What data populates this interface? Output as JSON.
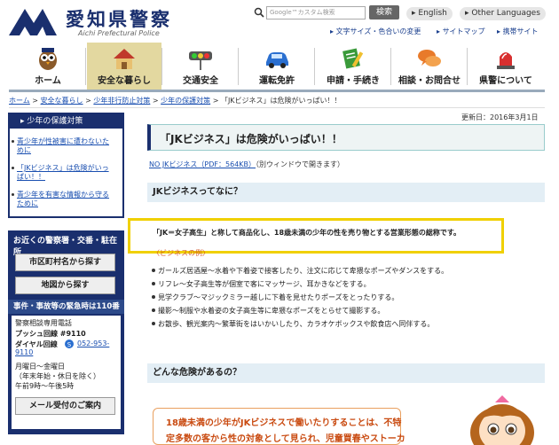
{
  "header": {
    "logo_text": "愛知県警察",
    "logo_sub": "Aichi Prefectural Police",
    "search_placeholder": "Google™カスタム検索",
    "search_button": "検索",
    "lang_english": "English",
    "lang_other": "Other Languages",
    "tools": [
      "文字サイズ・色合いの変更",
      "サイトマップ",
      "携帯サイト"
    ]
  },
  "nav": {
    "items": [
      {
        "label": "ホーム",
        "icon": "owl-icon"
      },
      {
        "label": "安全な暮らし",
        "icon": "house-icon"
      },
      {
        "label": "交通安全",
        "icon": "traffic-light-icon"
      },
      {
        "label": "運転免許",
        "icon": "car-icon"
      },
      {
        "label": "申請・手続き",
        "icon": "document-pencil-icon"
      },
      {
        "label": "相談・お問合せ",
        "icon": "speech-bubbles-icon"
      },
      {
        "label": "県警について",
        "icon": "siren-icon"
      }
    ],
    "active_index": 1
  },
  "breadcrumb": {
    "links": [
      "ホーム",
      "安全な暮らし",
      "少年非行防止対策",
      "少年の保護対策"
    ],
    "separator": " > ",
    "current": "「JKビジネス」は危険がいっぱい！！"
  },
  "sidebar": {
    "section_title": "少年の保護対策",
    "items": [
      "青少年が性被害に遭わないために",
      "「JKビジネス」は危険がいっぱい！！",
      "青少年を有害な情報から守るために"
    ],
    "police_title": "お近くの警察署・交番・駐在所",
    "btn_city": "市区町村名から探す",
    "btn_map": "地図から探す",
    "emergency_title": "事件・事故等の緊急時は110番",
    "contact": {
      "label1": "警察相談専用電話",
      "push": "プッシュ回線 #9110",
      "dial_label": "ダイヤル回線",
      "dial_num": "052-953-",
      "dial_num2": "9110",
      "hours1": "月曜日～金曜日",
      "hours2": "（年末年始・休日を除く）",
      "hours3": "午前9時～午後5時",
      "mail_button": "メール受付のご案内"
    }
  },
  "main": {
    "updated": "更新日：2016年3月1日",
    "title": "「JKビジネス」は危険がいっぱい！！",
    "pdf_link": "NO JKビジネス（PDF：564KB）",
    "pdf_note": "（別ウィンドウで開きます）",
    "section1": "JKビジネスってなに？",
    "definition": "「JK＝女子高生」と称して商品化し、18歳未満の少年の性を売り物とする営業形態の総称です。",
    "example_label": "〈ビジネスの例〉",
    "examples": [
      "ガールズ居酒屋～水着や下着姿で接客したり、注文に応じて卑猥なポーズやダンスをする。",
      "リフレ～女子高生等が個室で客にマッサージ、耳かきなどをする。",
      "見学クラブ～マジックミラー越しに下着を見せたりポーズをとったりする。",
      "撮影～制服や水着姿の女子高生等に卑猥なポーズをとらせて撮影する。",
      "お散歩、観光案内～繁華街をはいかいしたり、カラオケボックスや飲食店へ同伴する。"
    ],
    "section2": "どんな危険があるの？",
    "danger_line1": "18歳未満の少年がJKビジネスで働いたりすることは、不特",
    "danger_line2": "定多数の客から性の対象として見られ、児童買春やストーカ"
  },
  "colors": {
    "navy": "#1a2f6e",
    "highlight": "#f0d000",
    "link": "#1a4fb0",
    "danger_text": "#c94a10"
  }
}
